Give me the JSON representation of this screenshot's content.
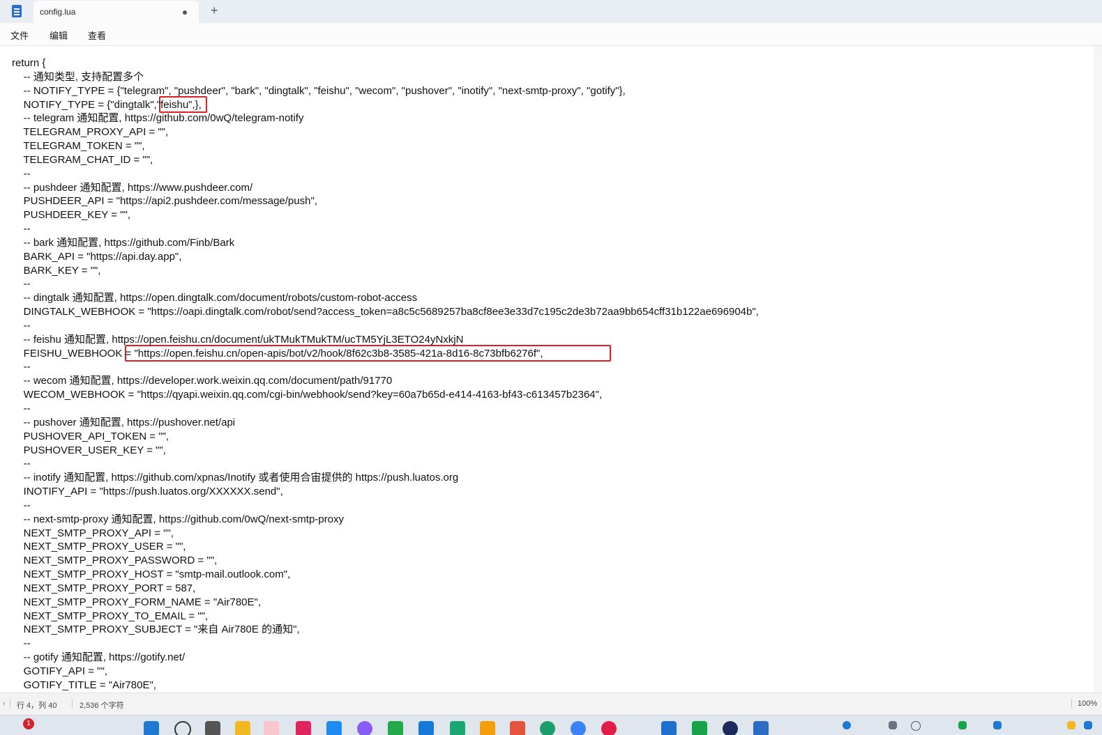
{
  "tab": {
    "title": "config.lua",
    "new_tab": "+"
  },
  "menu": [
    "文件",
    "编辑",
    "查看"
  ],
  "editor": {
    "lines": [
      "return {",
      "    -- 通知类型, 支持配置多个",
      "    -- NOTIFY_TYPE = {\"telegram\", \"pushdeer\", \"bark\", \"dingtalk\", \"feishu\", \"wecom\", \"pushover\", \"inotify\", \"next-smtp-proxy\", \"gotify\"},",
      "    NOTIFY_TYPE = {\"dingtalk\",\"feishu\",},",
      "    -- telegram 通知配置, https://github.com/0wQ/telegram-notify",
      "    TELEGRAM_PROXY_API = \"\",",
      "    TELEGRAM_TOKEN = \"\",",
      "    TELEGRAM_CHAT_ID = \"\",",
      "    --",
      "    -- pushdeer 通知配置, https://www.pushdeer.com/",
      "    PUSHDEER_API = \"https://api2.pushdeer.com/message/push\",",
      "    PUSHDEER_KEY = \"\",",
      "    --",
      "    -- bark 通知配置, https://github.com/Finb/Bark",
      "    BARK_API = \"https://api.day.app\",",
      "    BARK_KEY = \"\",",
      "    --",
      "    -- dingtalk 通知配置, https://open.dingtalk.com/document/robots/custom-robot-access",
      "    DINGTALK_WEBHOOK = \"https://oapi.dingtalk.com/robot/send?access_token=a8c5c5689257ba8cf8ee3e33d7c195c2de3b72aa9bb654cff31b122ae696904b\",",
      "    --",
      "    -- feishu 通知配置, https://open.feishu.cn/document/ukTMukTMukTM/ucTM5YjL3ETO24yNxkjN",
      "    FEISHU_WEBHOOK = \"https://open.feishu.cn/open-apis/bot/v2/hook/8f62c3b8-3585-421a-8d16-8c73bfb6276f\",",
      "    --",
      "    -- wecom 通知配置, https://developer.work.weixin.qq.com/document/path/91770",
      "    WECOM_WEBHOOK = \"https://qyapi.weixin.qq.com/cgi-bin/webhook/send?key=60a7b65d-e414-4163-bf43-c613457b2364\",",
      "    --",
      "    -- pushover 通知配置, https://pushover.net/api",
      "    PUSHOVER_API_TOKEN = \"\",",
      "    PUSHOVER_USER_KEY = \"\",",
      "    --",
      "    -- inotify 通知配置, https://github.com/xpnas/Inotify 或者使用合宙提供的 https://push.luatos.org",
      "    INOTIFY_API = \"https://push.luatos.org/XXXXXX.send\",",
      "    --",
      "    -- next-smtp-proxy 通知配置, https://github.com/0wQ/next-smtp-proxy",
      "    NEXT_SMTP_PROXY_API = \"\",",
      "    NEXT_SMTP_PROXY_USER = \"\",",
      "    NEXT_SMTP_PROXY_PASSWORD = \"\",",
      "    NEXT_SMTP_PROXY_HOST = \"smtp-mail.outlook.com\",",
      "    NEXT_SMTP_PROXY_PORT = 587,",
      "    NEXT_SMTP_PROXY_FORM_NAME = \"Air780E\",",
      "    NEXT_SMTP_PROXY_TO_EMAIL = \"\",",
      "    NEXT_SMTP_PROXY_SUBJECT = \"来自 Air780E 的通知\",",
      "    --",
      "    -- gotify 通知配置, https://gotify.net/",
      "    GOTIFY_API = \"\",",
      "    GOTIFY_TITLE = \"Air780E\","
    ]
  },
  "status": {
    "position": "行 4，列 40",
    "chars": "2,536 个字符",
    "zoom": "100%"
  },
  "taskbar": {
    "badge": "1"
  },
  "colors": {
    "highlight": "#e02020",
    "accent": "#2b6cc4"
  }
}
